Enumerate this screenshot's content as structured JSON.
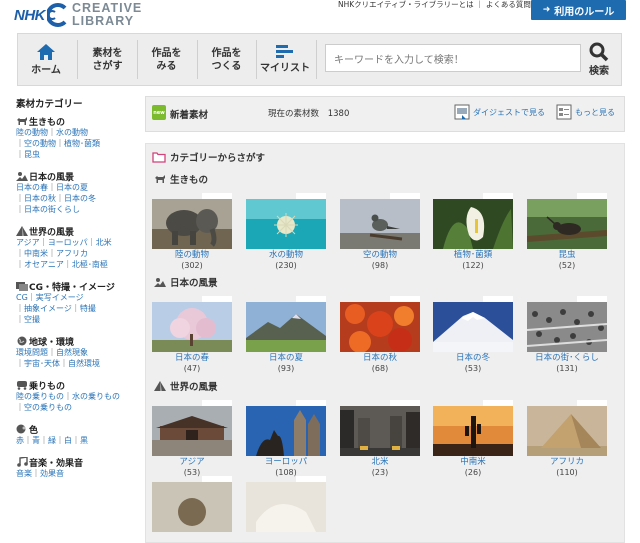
{
  "header": {
    "logo_nhk": "NHK",
    "logo_line1": "CREATIVE",
    "logo_line2": "LIBRARY",
    "about_link": "NHKクリエイティブ・ライブラリーとは",
    "faq_link": "よくある質問",
    "rules_button": "利用のルール"
  },
  "nav": {
    "home": "ホーム",
    "find_line1": "素材を",
    "find_line2": "さがす",
    "view_line1": "作品を",
    "view_line2": "みる",
    "make_line1": "作品を",
    "make_line2": "つくる",
    "mylist": "マイリスト",
    "search_placeholder": "キーワードを入力して検索！",
    "search_label": "検索"
  },
  "sidebar": {
    "heading": "素材カテゴリー",
    "categories": [
      {
        "title": "生きもの",
        "icon": "animal-icon",
        "links": [
          "陸の動物",
          "水の動物",
          "空の動物",
          "植物･菌類",
          "昆虫"
        ]
      },
      {
        "title": "日本の風景",
        "icon": "landscape-icon",
        "links": [
          "日本の春",
          "日本の夏",
          "日本の秋",
          "日本の冬",
          "日本の街くらし"
        ]
      },
      {
        "title": "世界の風景",
        "icon": "pyramid-icon",
        "links": [
          "アジア",
          "ヨーロッパ",
          "北米",
          "中南米",
          "アフリカ",
          "オセアニア",
          "北極･南極"
        ]
      },
      {
        "title": "CG・特撮・イメージ",
        "icon": "cg-icon",
        "links": [
          "CG",
          "実写イメージ",
          "抽象イメージ",
          "特撮",
          "空撮"
        ]
      },
      {
        "title": "地球・環境",
        "icon": "globe-icon",
        "links": [
          "環境問題",
          "自然現象",
          "宇宙･天体",
          "自然環境"
        ]
      },
      {
        "title": "乗りもの",
        "icon": "vehicle-icon",
        "links": [
          "陸の乗りもの",
          "水の乗りもの",
          "空の乗りもの"
        ]
      },
      {
        "title": "色",
        "icon": "color-icon",
        "links": [
          "赤",
          "青",
          "緑",
          "白",
          "黒"
        ]
      },
      {
        "title": "音楽・効果音",
        "icon": "music-icon",
        "links": [
          "音楽",
          "効果音"
        ]
      }
    ]
  },
  "newbar": {
    "badge": "new",
    "title": "新着素材",
    "count_label": "現在の素材数",
    "count_value": "1380",
    "digest_link": "ダイジェストで見る",
    "more_link": "もっと見る"
  },
  "panel": {
    "title": "カテゴリーからさがす",
    "sections": [
      {
        "title": "生きもの",
        "items": [
          {
            "label": "陸の動物",
            "count": "(302)",
            "scene": "elephant"
          },
          {
            "label": "水の動物",
            "count": "(230)",
            "scene": "pufferfish"
          },
          {
            "label": "空の動物",
            "count": "(98)",
            "scene": "bird"
          },
          {
            "label": "植物･菌類",
            "count": "(122)",
            "scene": "calla"
          },
          {
            "label": "昆虫",
            "count": "(52)",
            "scene": "beetle"
          }
        ]
      },
      {
        "title": "日本の風景",
        "items": [
          {
            "label": "日本の春",
            "count": "(47)",
            "scene": "sakura"
          },
          {
            "label": "日本の夏",
            "count": "(93)",
            "scene": "mountain"
          },
          {
            "label": "日本の秋",
            "count": "(68)",
            "scene": "maple"
          },
          {
            "label": "日本の冬",
            "count": "(53)",
            "scene": "fuji"
          },
          {
            "label": "日本の街･くらし",
            "count": "(131)",
            "scene": "crowd"
          }
        ]
      },
      {
        "title": "世界の風景",
        "items": [
          {
            "label": "アジア",
            "count": "(53)",
            "scene": "temple"
          },
          {
            "label": "ヨーロッパ",
            "count": "(108)",
            "scene": "cathedral"
          },
          {
            "label": "北米",
            "count": "(23)",
            "scene": "city"
          },
          {
            "label": "中南米",
            "count": "(26)",
            "scene": "cactus"
          },
          {
            "label": "アフリカ",
            "count": "(110)",
            "scene": "pyramid"
          }
        ]
      }
    ]
  },
  "colors": {
    "link": "#2a74b8",
    "brand": "#1d5fa8",
    "button": "#1f6bb0",
    "new": "#7dbb2e"
  }
}
